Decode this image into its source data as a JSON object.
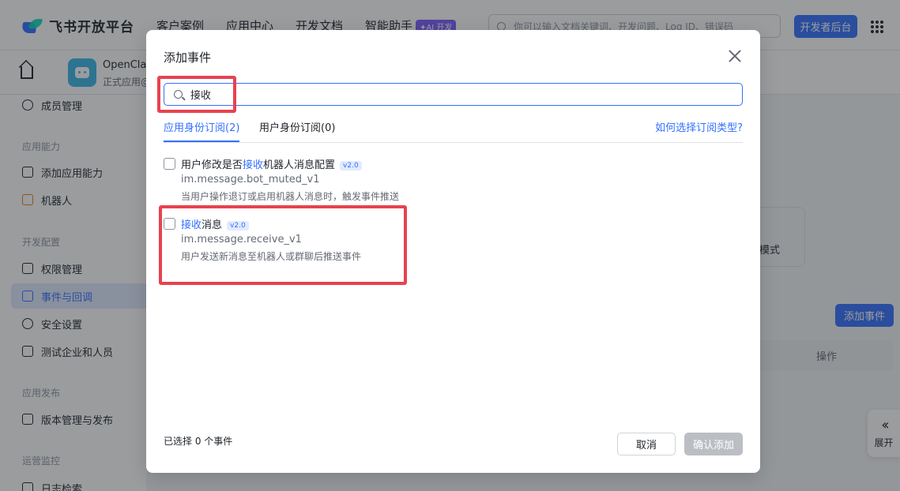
{
  "topnav": {
    "logo_text": "飞书开放平台",
    "items": [
      "客户案例",
      "应用中心",
      "开发文档",
      "智能助手"
    ],
    "ai_badge": "✦AI 开发",
    "search_placeholder": "你可以输入文档关键词、开发问题、Log ID、错误码",
    "dev_console_label": "开发者后台"
  },
  "app": {
    "name": "OpenClaw",
    "status": "正式应用@"
  },
  "sidebar": {
    "items": [
      {
        "label": "成员管理",
        "icon": "user-icon"
      },
      {
        "group": "应用能力"
      },
      {
        "label": "添加应用能力",
        "icon": "grid-icon"
      },
      {
        "label": "机器人",
        "icon": "robot-icon"
      },
      {
        "group": "开发配置"
      },
      {
        "label": "权限管理",
        "icon": "lock-icon"
      },
      {
        "label": "事件与回调",
        "icon": "event-icon",
        "active": true
      },
      {
        "label": "安全设置",
        "icon": "shield-icon"
      },
      {
        "label": "测试企业和人员",
        "icon": "code-icon"
      },
      {
        "group": "应用发布"
      },
      {
        "label": "版本管理与发布",
        "icon": "upload-icon"
      },
      {
        "group": "运营监控"
      },
      {
        "label": "日志检索",
        "icon": "log-icon"
      }
    ]
  },
  "background": {
    "card_text": "模式",
    "add_event_label": "添加事件",
    "table_action_header": "操作",
    "expand_label": "展开"
  },
  "modal": {
    "title": "添加事件",
    "search_value": "接收",
    "tabs": [
      {
        "label": "应用身份订阅(2)",
        "active": true
      },
      {
        "label": "用户身份订阅(0)",
        "active": false
      }
    ],
    "help_link": "如何选择订阅类型?",
    "events": [
      {
        "name_prefix": "用户修改是否",
        "name_keyword": "接收",
        "name_suffix": "机器人消息配置",
        "version": "v2.0",
        "key": "im.message.bot_muted_v1",
        "description": "当用户操作退订或启用机器人消息时，触发事件推送",
        "checked": false
      },
      {
        "name_prefix": "",
        "name_keyword": "接收",
        "name_suffix": "消息",
        "version": "v2.0",
        "key": "im.message.receive_v1",
        "description": "用户发送新消息至机器人或群聊后推送事件",
        "checked": false
      }
    ],
    "selected_count": "已选择 0 个事件",
    "cancel_label": "取消",
    "confirm_label": "确认添加"
  },
  "colors": {
    "accent": "#3370ff",
    "highlight": "#e8424f"
  }
}
